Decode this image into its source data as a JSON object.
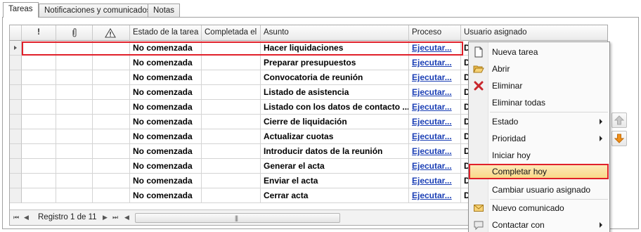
{
  "tabs": [
    {
      "label": "Tareas",
      "active": true
    },
    {
      "label": "Notificaciones y comunicados",
      "active": false
    },
    {
      "label": "Notas",
      "active": false
    }
  ],
  "grid": {
    "columns": {
      "priority": "!",
      "attachment_icon": "paperclip-icon",
      "alert_icon": "warning-icon",
      "estado": "Estado de la tarea",
      "completada": "Completada el",
      "asunto": "Asunto",
      "proceso": "Proceso",
      "usuario": "Usuario asignado"
    },
    "rows": [
      {
        "estado": "No comenzada",
        "completada": "",
        "asunto": "Hacer liquidaciones",
        "proceso": "Ejecutar...",
        "usuario": "D"
      },
      {
        "estado": "No comenzada",
        "completada": "",
        "asunto": "Preparar presupuestos",
        "proceso": "Ejecutar...",
        "usuario": "D"
      },
      {
        "estado": "No comenzada",
        "completada": "",
        "asunto": "Convocatoria de reunión",
        "proceso": "Ejecutar...",
        "usuario": "D"
      },
      {
        "estado": "No comenzada",
        "completada": "",
        "asunto": "Listado de asistencia",
        "proceso": "Ejecutar...",
        "usuario": "D"
      },
      {
        "estado": "No comenzada",
        "completada": "",
        "asunto": "Listado con los datos de contacto ...",
        "proceso": "Ejecutar...",
        "usuario": "D"
      },
      {
        "estado": "No comenzada",
        "completada": "",
        "asunto": "Cierre de liquidación",
        "proceso": "Ejecutar...",
        "usuario": "D"
      },
      {
        "estado": "No comenzada",
        "completada": "",
        "asunto": "Actualizar cuotas",
        "proceso": "Ejecutar...",
        "usuario": "D"
      },
      {
        "estado": "No comenzada",
        "completada": "",
        "asunto": "Introducir datos de la reunión",
        "proceso": "Ejecutar...",
        "usuario": "D"
      },
      {
        "estado": "No comenzada",
        "completada": "",
        "asunto": "Generar el acta",
        "proceso": "Ejecutar...",
        "usuario": "D"
      },
      {
        "estado": "No comenzada",
        "completada": "",
        "asunto": "Enviar el acta",
        "proceso": "Ejecutar...",
        "usuario": "D"
      },
      {
        "estado": "No comenzada",
        "completada": "",
        "asunto": "Cerrar acta",
        "proceso": "Ejecutar...",
        "usuario": "D"
      }
    ],
    "navigator": {
      "record_text": "Registro 1 de 11",
      "scroll_grip": "|||"
    }
  },
  "context_menu": {
    "items": [
      {
        "label": "Nueva tarea",
        "icon": "new-document-icon"
      },
      {
        "label": "Abrir",
        "icon": "folder-open-icon"
      },
      {
        "label": "Eliminar",
        "icon": "delete-x-icon"
      },
      {
        "label": "Eliminar todas",
        "icon": ""
      },
      {
        "label": "Estado",
        "submenu": true
      },
      {
        "label": "Prioridad",
        "submenu": true
      },
      {
        "label": "Iniciar hoy"
      },
      {
        "label": "Completar hoy",
        "highlighted": true
      },
      {
        "label": "Cambiar usuario asignado"
      },
      {
        "label": "Nuevo comunicado",
        "icon": "envelope-icon"
      },
      {
        "label": "Contactar con",
        "icon": "chat-icon",
        "submenu": true
      }
    ]
  },
  "colors": {
    "link": "#1b3fb5",
    "selection_outline": "#e0202a",
    "menu_highlight": "#f9d989",
    "move_down_arrow": "#f0901a"
  }
}
